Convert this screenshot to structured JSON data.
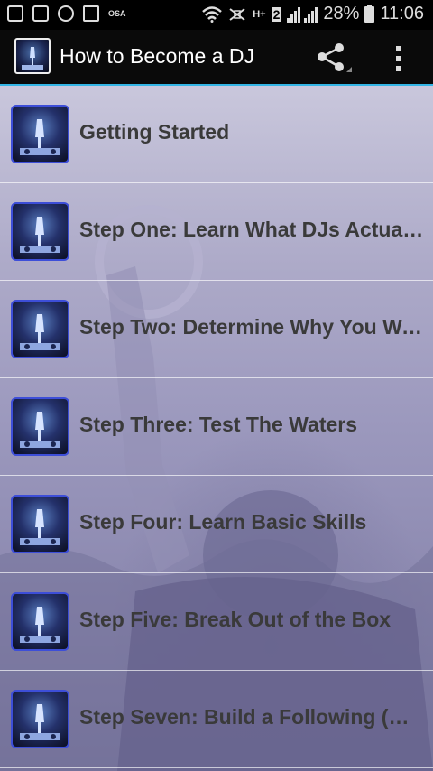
{
  "status_bar": {
    "network_type": "H+",
    "sim_slot": "2",
    "battery_percent": "28%",
    "time": "11:06",
    "osa_label": "OSA",
    "icons": [
      "bbm-icon",
      "doc-icon",
      "messenger-icon",
      "image-icon",
      "wifi-icon",
      "mute-icon",
      "signal-icon",
      "battery-icon"
    ]
  },
  "action_bar": {
    "title": "How to Become a DJ",
    "icons": [
      "app-icon",
      "share-icon",
      "overflow-menu-icon"
    ]
  },
  "list": {
    "items": [
      {
        "label": "Getting Started"
      },
      {
        "label": "Step One: Learn What DJs Actuall..."
      },
      {
        "label": "Step Two: Determine Why You Wa..."
      },
      {
        "label": "Step Three: Test The Waters"
      },
      {
        "label": "Step Four: Learn Basic Skills"
      },
      {
        "label": "Step Five: Break Out of the Box"
      },
      {
        "label": "Step Seven: Build a Following (Br..."
      }
    ]
  },
  "colors": {
    "accent": "#33b5e5",
    "thumb_border": "#3d4ed8",
    "item_text": "#3a3a3a"
  }
}
